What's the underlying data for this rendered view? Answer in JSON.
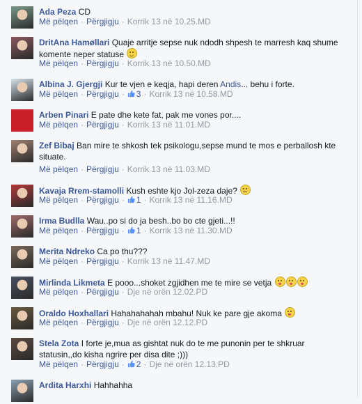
{
  "actions": {
    "like": "Më pëlqen",
    "reply": "Përgjigju",
    "dot": "·"
  },
  "comments": [
    {
      "name": "Ada Peza",
      "text": "CD",
      "likes": "",
      "time": "Korrik 13 në 10.25.MD",
      "avatar": "#7a9a8a"
    },
    {
      "name": "DritAna Hamøllari",
      "text": "Quaje arritje sepse nuk ndodh shpesh te marresh kaq shume komente neper statuse",
      "likes": "",
      "time": "Korrik 13 në 10.50.MD",
      "avatar": "#8a5a60",
      "emoji": "smile"
    },
    {
      "name": "Albina J. Gjergji",
      "text": "Kur te vjen e keqja, hapi deren",
      "link": "Andis",
      "text2": "... behu i forte.",
      "likes": "3",
      "time": "Korrik 13 në 10.58.MD",
      "avatar": "#d6e2ea"
    },
    {
      "name": "Arben Pinari",
      "text": "E pate dhe kete fat, pak me vones por....",
      "likes": "",
      "time": "Korrik 13 në 11.01.MD",
      "avatar": "#c8202a"
    },
    {
      "name": "Zef Bibaj",
      "text": "Ban mire te shkosh tek psikologu,sepse mund te mos e perballosh kte situate.",
      "likes": "",
      "time": "Korrik 13 në 11.03.MD",
      "avatar": "#a08070"
    },
    {
      "name": "Kavaja Rrem-stamolli",
      "text": "Kush eshte kjo Jol-zeza daje?",
      "likes": "1",
      "time": "Korrik 13 në 11.16.MD",
      "avatar": "#b23a3a",
      "emoji": "meh"
    },
    {
      "name": "Irma Budlla",
      "text": "Wau..po si do ja besh..bo bo cte gjeti...!!",
      "likes": "1",
      "time": "Korrik 13 në 11.30.MD",
      "avatar": "#a06a6a"
    },
    {
      "name": "Merita Ndreko",
      "text": "Ca po thu???",
      "likes": "",
      "time": "Korrik 13 në 11.47.MD",
      "avatar": "#7a6a5a"
    },
    {
      "name": "Mirlinda Likmeta",
      "text": "E pooo...shoket zgjidhen me te mire se vetja",
      "likes": "",
      "time": "Dje në orën 12.02.PD",
      "avatar": "#4a5060",
      "emoji": "tongue3"
    },
    {
      "name": "Oraldo Hoxhallari",
      "text": "Hahahahahah mbahu! Nuk ke pare gje akoma",
      "likes": "",
      "time": "Dje në orën 12.12.PD",
      "avatar": "#6a5a40",
      "emoji": "tongue"
    },
    {
      "name": "Stela Zota",
      "text": "I forte je,mua as gishtat nuk do te me punonin per te shkruar statusin,,do kisha ngrire per disa dite ;)))",
      "likes": "2",
      "time": "Dje në orën 12.13.PD",
      "avatar": "#5a4a40"
    },
    {
      "name": "Ardita Harxhi",
      "text": "Hahhahha",
      "likes": "",
      "time": "",
      "avatar": "#8aa0b0"
    }
  ]
}
